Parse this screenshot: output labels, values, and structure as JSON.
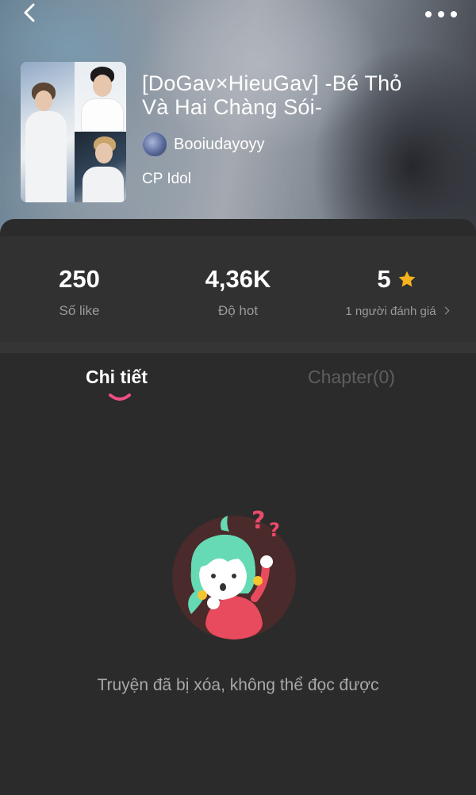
{
  "header": {
    "back_icon": "chevron-left-icon",
    "more_icon": "more-horizontal-icon"
  },
  "story": {
    "title_line1": "[DoGav×HieuGav] -Bé Thỏ",
    "title_line2": "Và Hai Chàng Sói-",
    "author": "Booiudayoyy",
    "category": "CP Idol"
  },
  "stats": {
    "likes": {
      "value": "250",
      "label": "Số like"
    },
    "hot": {
      "value": "4,36K",
      "label": "Độ hot"
    },
    "rating": {
      "value": "5",
      "label": "1 người đánh giá",
      "icon": "star-icon"
    }
  },
  "tabs": [
    {
      "label": "Chi tiết",
      "active": true
    },
    {
      "label": "Chapter(0)",
      "active": false
    }
  ],
  "empty_state": {
    "message": "Truyện đã bị xóa, không thể đọc được"
  },
  "colors": {
    "background": "#2b2b2b",
    "stats_panel": "#313131",
    "accent_pink": "#ef4f86",
    "star_yellow": "#f5b41d",
    "muted_text": "#9a9a9a",
    "inactive_tab": "#5e5e5e"
  }
}
